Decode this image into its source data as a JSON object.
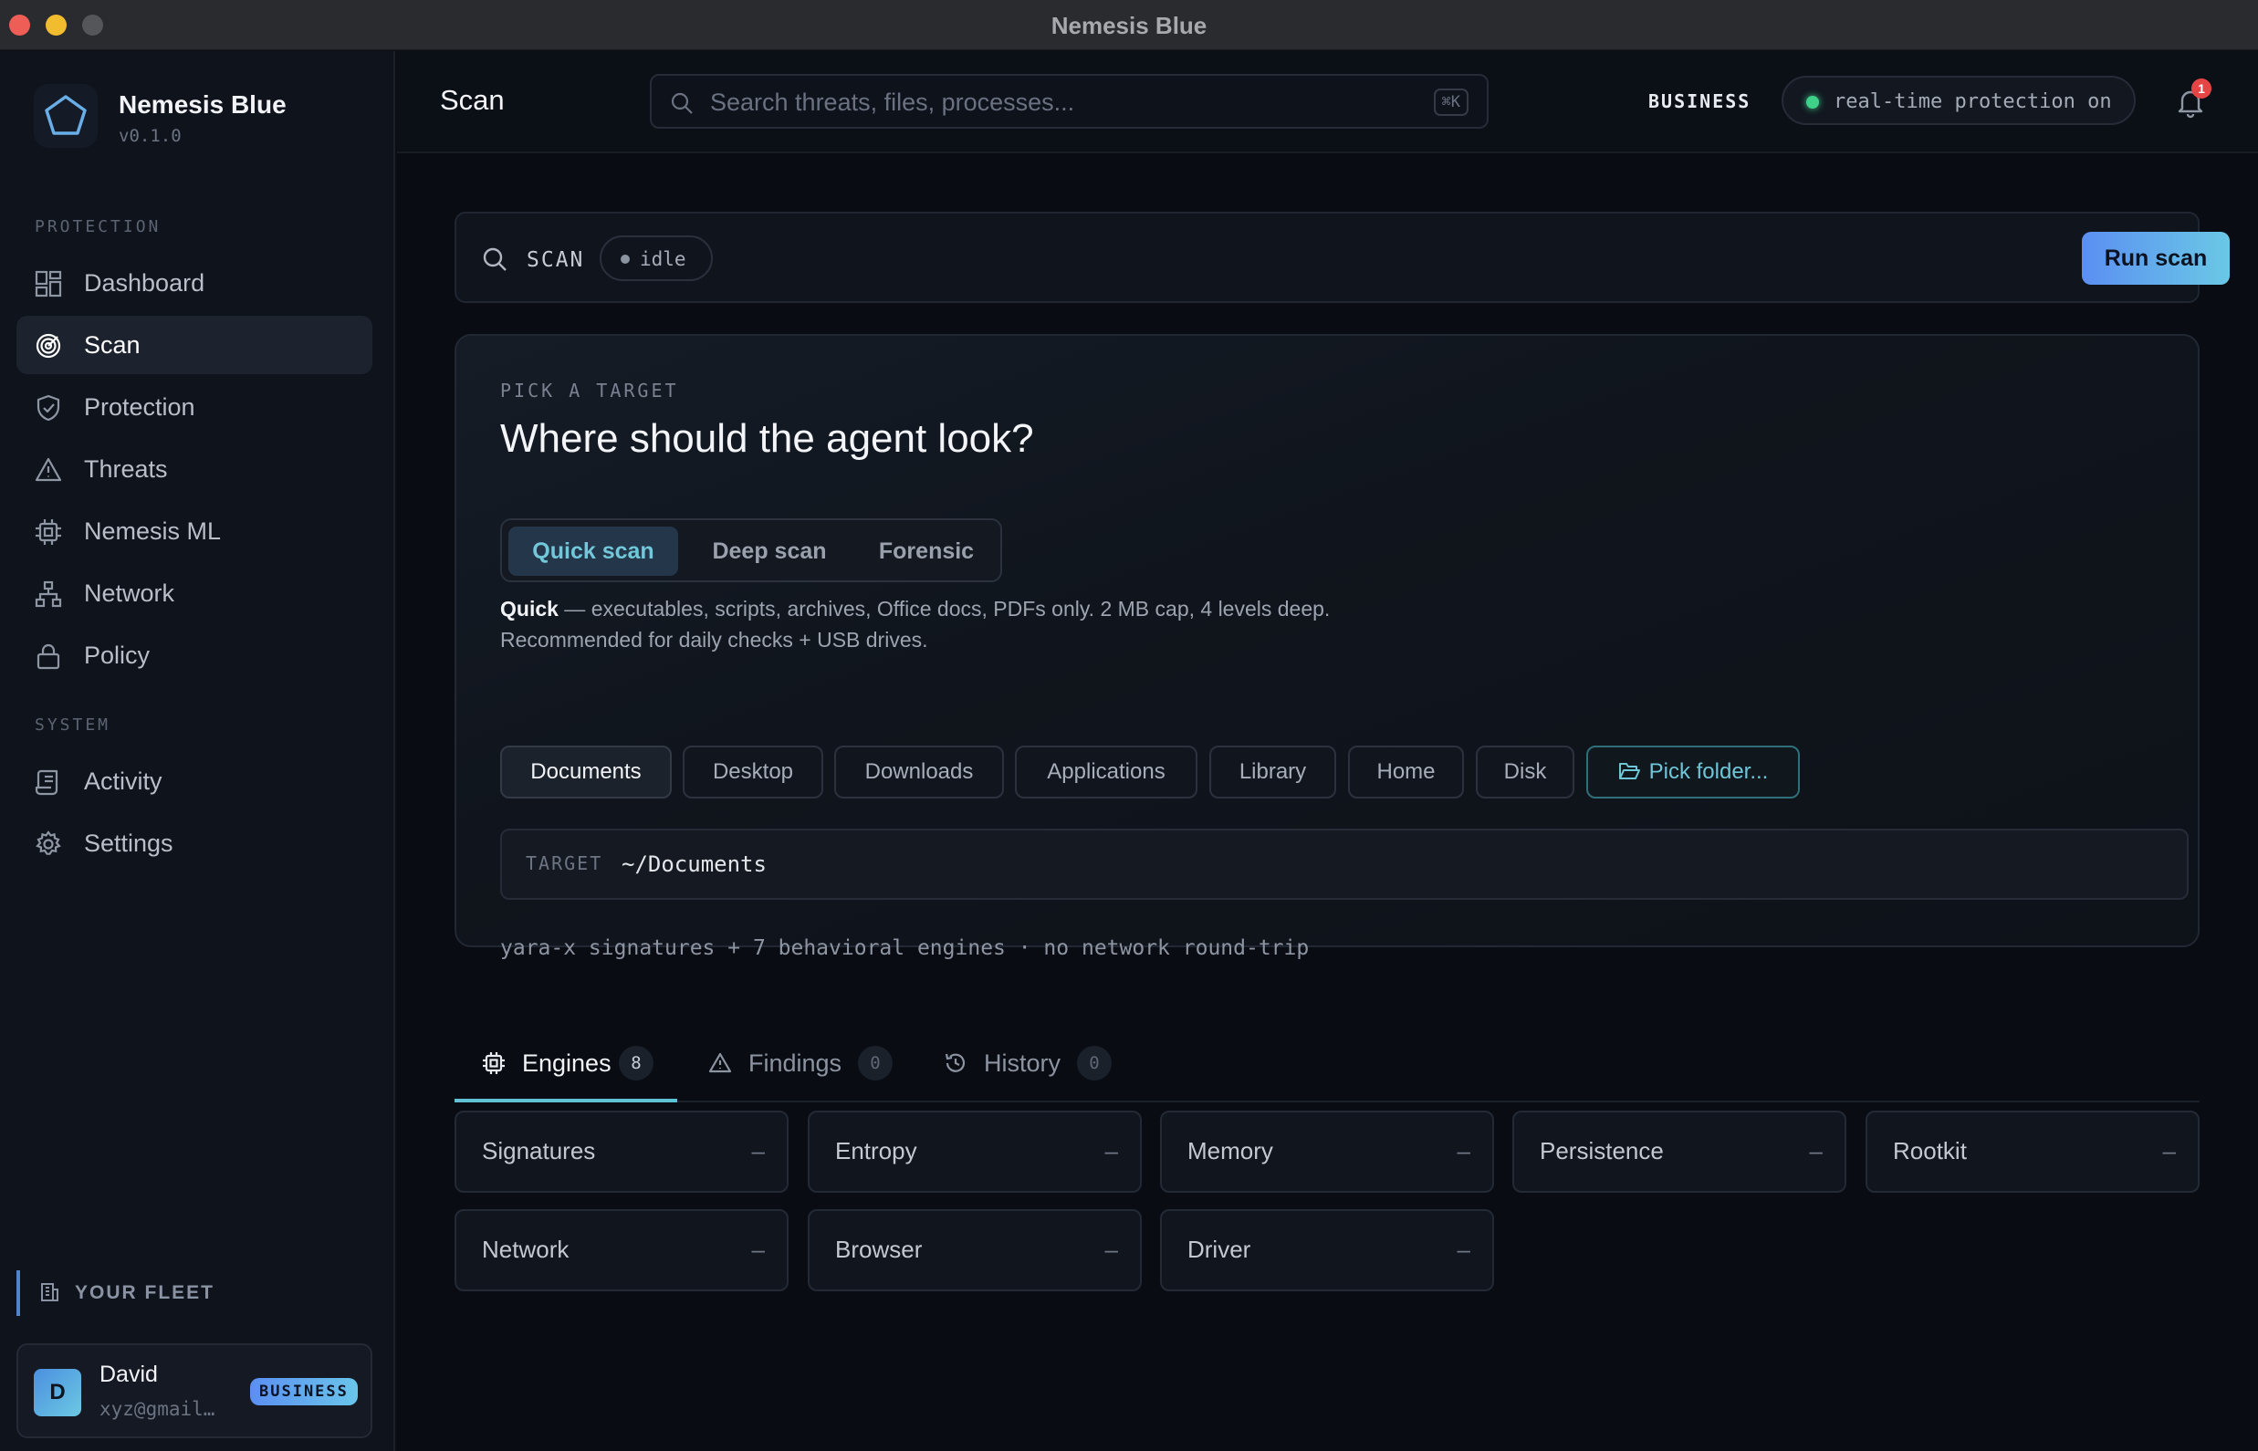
{
  "window": {
    "title": "Nemesis Blue"
  },
  "brand": {
    "name": "Nemesis Blue",
    "version": "v0.1.0"
  },
  "sidebar": {
    "section_protection": "PROTECTION",
    "section_system": "SYSTEM",
    "items": [
      {
        "label": "Dashboard",
        "icon": "dashboard-icon",
        "active": false
      },
      {
        "label": "Scan",
        "icon": "radar-icon",
        "active": true
      },
      {
        "label": "Protection",
        "icon": "shield-icon",
        "active": false
      },
      {
        "label": "Threats",
        "icon": "warning-icon",
        "active": false
      },
      {
        "label": "Nemesis ML",
        "icon": "chip-icon",
        "active": false
      },
      {
        "label": "Network",
        "icon": "network-icon",
        "active": false
      },
      {
        "label": "Policy",
        "icon": "lock-icon",
        "active": false
      }
    ],
    "system_items": [
      {
        "label": "Activity",
        "icon": "scroll-icon"
      },
      {
        "label": "Settings",
        "icon": "gear-icon"
      }
    ],
    "fleet_label": "YOUR FLEET",
    "user": {
      "initial": "D",
      "name": "David",
      "email": "xyz@gmail…",
      "badge": "BUSINESS"
    }
  },
  "header": {
    "title": "Scan",
    "search_placeholder": "Search threats, files, processes...",
    "search_value": "",
    "shortcut": "⌘K",
    "plan": "BUSINESS",
    "protection_status": "real-time protection on",
    "notification_count": "1"
  },
  "scanbar": {
    "label": "SCAN",
    "status": "idle",
    "run_label": "Run scan"
  },
  "target": {
    "eyebrow": "PICK A TARGET",
    "title": "Where should the agent look?",
    "modes": [
      "Quick scan",
      "Deep scan",
      "Forensic"
    ],
    "active_mode": "Quick scan",
    "desc_mode": "Quick",
    "desc_line1": " — executables, scripts, archives, Office docs, PDFs only. 2 MB cap, 4 levels deep.",
    "desc_line2": "Recommended for daily checks + USB drives.",
    "locations": [
      "Documents",
      "Desktop",
      "Downloads",
      "Applications",
      "Library",
      "Home",
      "Disk"
    ],
    "active_location": "Documents",
    "pick_folder": "Pick folder...",
    "target_key": "TARGET",
    "target_value": "~/Documents",
    "note": "yara-x signatures + 7 behavioral engines · no network round-trip"
  },
  "tabs": [
    {
      "label": "Engines",
      "count": "8",
      "active": true
    },
    {
      "label": "Findings",
      "count": "0",
      "active": false
    },
    {
      "label": "History",
      "count": "0",
      "active": false
    }
  ],
  "engines": [
    {
      "name": "Signatures",
      "value": "–"
    },
    {
      "name": "Entropy",
      "value": "–"
    },
    {
      "name": "Memory",
      "value": "–"
    },
    {
      "name": "Persistence",
      "value": "–"
    },
    {
      "name": "Rootkit",
      "value": "–"
    },
    {
      "name": "Network",
      "value": "–"
    },
    {
      "name": "Browser",
      "value": "–"
    },
    {
      "name": "Driver",
      "value": "–"
    }
  ],
  "colors": {
    "accent": "#6fc6d8",
    "brand_gradient_start": "#5b8ff2",
    "brand_gradient_end": "#6ac8e5",
    "status_on": "#3fd08a",
    "notification": "#e64545"
  }
}
